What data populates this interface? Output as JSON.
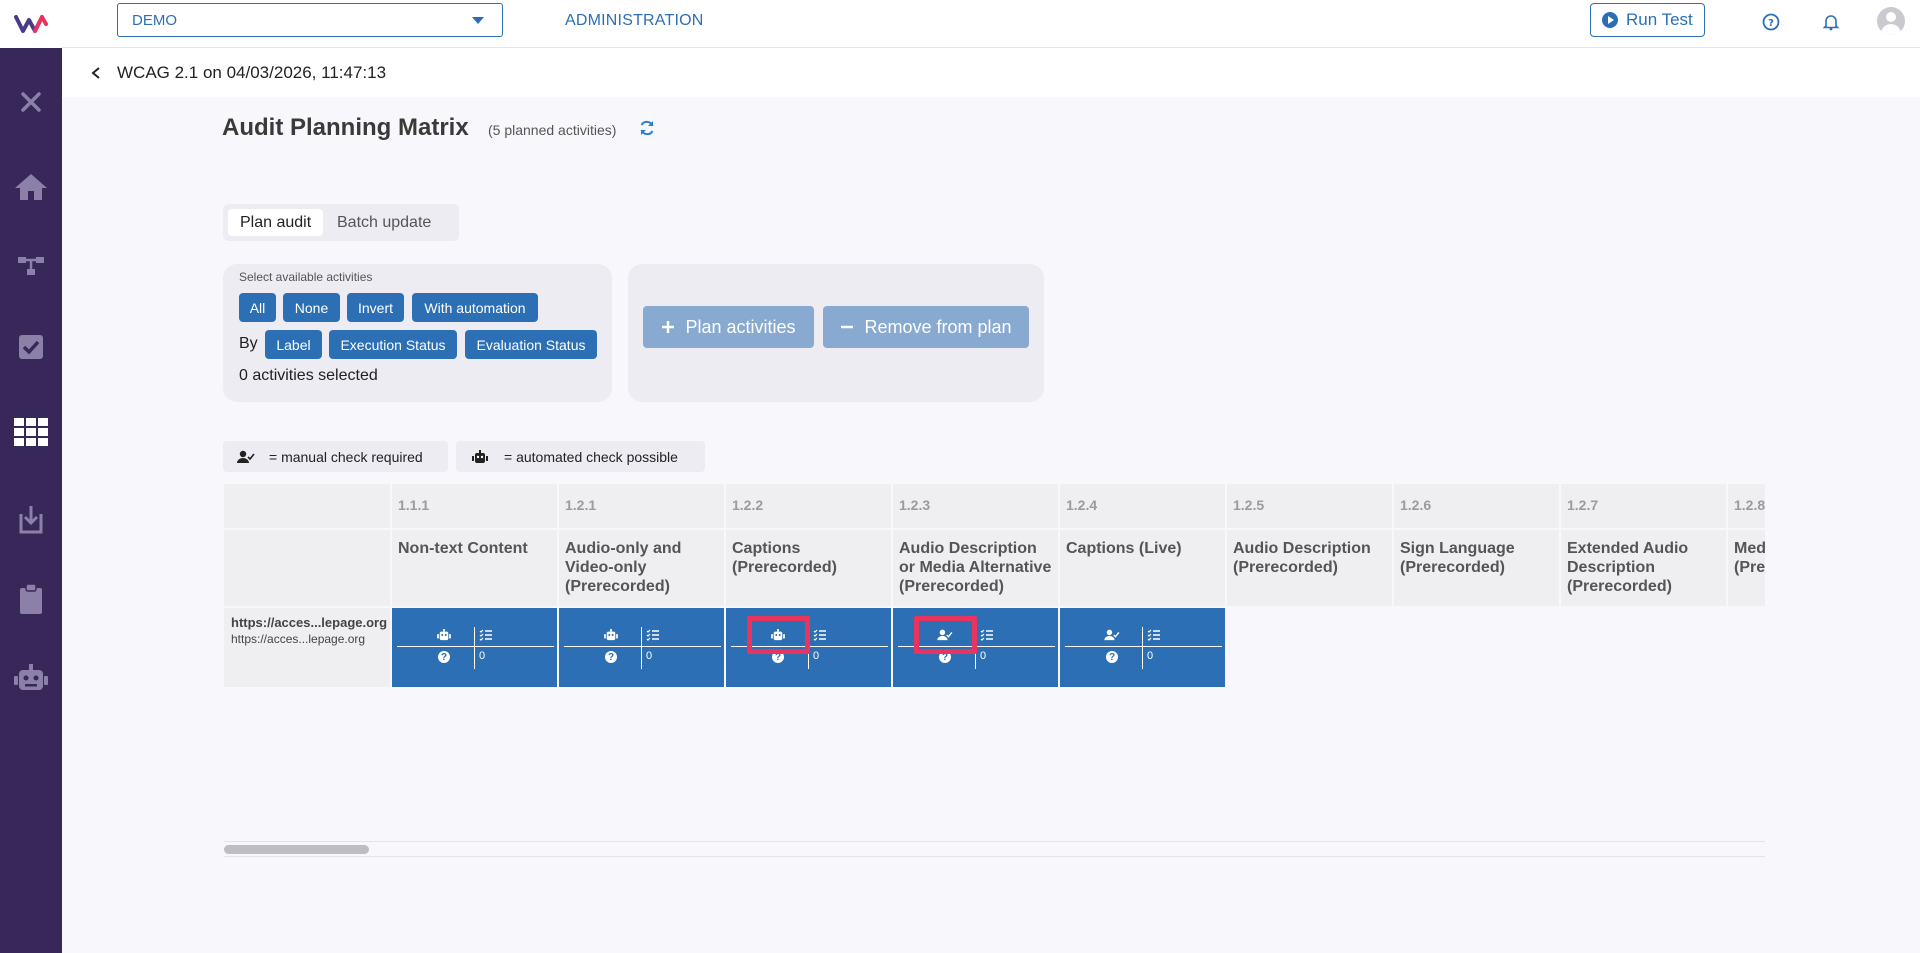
{
  "topbar": {
    "project": "DEMO",
    "admin_label": "ADMINISTRATION",
    "run_test_label": "Run Test"
  },
  "subheader": {
    "title": "WCAG 2.1 on 04/03/2026, 11:47:13"
  },
  "sidebar": {
    "items": [
      "close-icon",
      "home-icon",
      "flow-icon",
      "checkbox-icon",
      "grid-icon",
      "import-icon",
      "clipboard-icon",
      "robot-icon"
    ]
  },
  "main": {
    "title": "Audit Planning Matrix",
    "planned_count": "(5 planned activities)",
    "tabs": [
      {
        "label": "Plan audit"
      },
      {
        "label": "Batch update"
      }
    ],
    "select_panel": {
      "label": "Select available activities",
      "row1": [
        "All",
        "None",
        "Invert",
        "With automation"
      ],
      "by_label": "By",
      "row2": [
        "Label",
        "Execution Status",
        "Evaluation Status"
      ],
      "selected_count": "0 activities selected"
    },
    "plan_panel": {
      "plan_label": "Plan activities",
      "remove_label": "Remove from plan"
    },
    "legend": {
      "manual": "= manual check required",
      "automated": "= automated check possible"
    }
  },
  "matrix": {
    "columns": [
      {
        "num": "1.1.1",
        "name": "Non-text Content"
      },
      {
        "num": "1.2.1",
        "name": "Audio-only and Video-only (Prerecorded)"
      },
      {
        "num": "1.2.2",
        "name": "Captions (Prerecorded)"
      },
      {
        "num": "1.2.3",
        "name": "Audio Description or Media Alternative (Prerecorded)"
      },
      {
        "num": "1.2.4",
        "name": "Captions (Live)"
      },
      {
        "num": "1.2.5",
        "name": "Audio Description (Prerecorded)"
      },
      {
        "num": "1.2.6",
        "name": "Sign Language (Prerecorded)"
      },
      {
        "num": "1.2.7",
        "name": "Extended Audio Description (Prerecorded)"
      },
      {
        "num": "1.2.8",
        "name": "Media Alternative (Prerecorded)"
      }
    ],
    "row": {
      "label_bold": "https://acces...lepage.org",
      "label_sub": "https://acces...lepage.org",
      "cells": [
        {
          "icon": "robot-icon",
          "count": "0"
        },
        {
          "icon": "robot-icon",
          "count": "0"
        },
        {
          "icon": "robot-icon",
          "count": "0"
        },
        {
          "icon": "user-check-icon",
          "count": "0"
        },
        {
          "icon": "user-check-icon",
          "count": "0"
        }
      ]
    }
  }
}
